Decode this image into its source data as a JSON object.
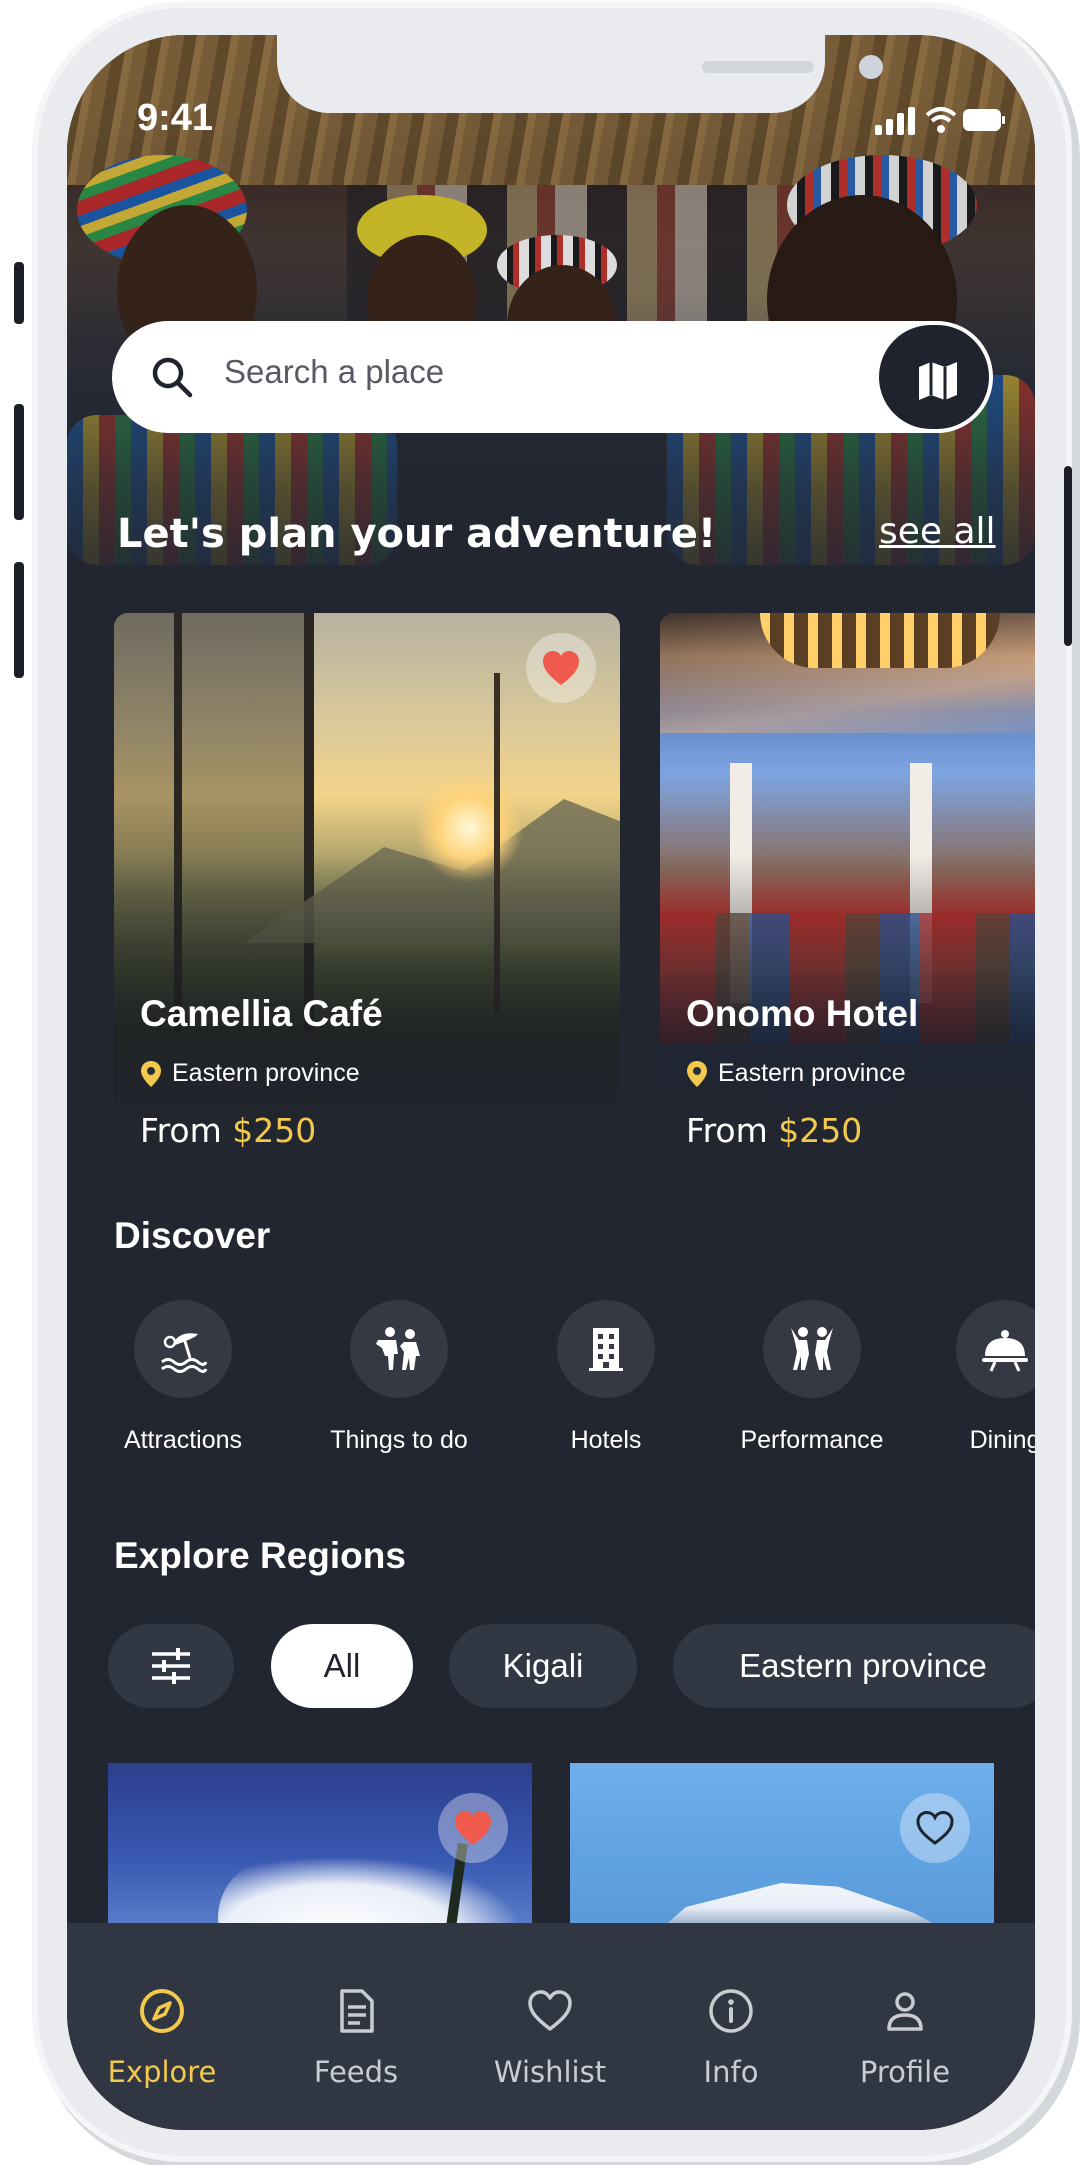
{
  "status_bar": {
    "time": "9:41"
  },
  "search": {
    "placeholder": "Search a place",
    "icon": "search-icon",
    "map_button_icon": "map-icon"
  },
  "plan": {
    "title": "Let's plan your adventure!",
    "see_all": "see all",
    "cards": [
      {
        "name": "Camellia Café",
        "location": "Eastern province",
        "price_prefix": "From",
        "price": "$250",
        "favorited": true
      },
      {
        "name": "Onomo Hotel",
        "location": "Eastern province",
        "price_prefix": "From",
        "price": "$250",
        "favorited": false
      }
    ]
  },
  "discover": {
    "title": "Discover",
    "items": [
      {
        "label": "Attractions",
        "icon": "beach-umbrella-icon"
      },
      {
        "label": "Things to do",
        "icon": "people-activity-icon"
      },
      {
        "label": "Hotels",
        "icon": "building-icon"
      },
      {
        "label": "Performance",
        "icon": "dancers-icon"
      },
      {
        "label": "Dining",
        "icon": "cloche-icon"
      }
    ]
  },
  "regions": {
    "title": "Explore Regions",
    "filter_icon": "sliders-icon",
    "chips": [
      "All",
      "Kigali",
      "Eastern province"
    ],
    "active_chip": "All",
    "cards": [
      {
        "favorited": true
      },
      {
        "favorited": false
      }
    ]
  },
  "nav": {
    "items": [
      {
        "label": "Explore",
        "icon": "compass-icon",
        "active": true
      },
      {
        "label": "Feeds",
        "icon": "document-icon",
        "active": false
      },
      {
        "label": "Wishlist",
        "icon": "heart-outline-icon",
        "active": false
      },
      {
        "label": "Info",
        "icon": "info-icon",
        "active": false
      },
      {
        "label": "Profile",
        "icon": "person-icon",
        "active": false
      }
    ]
  },
  "colors": {
    "background": "#222630",
    "accent": "#f2c94c",
    "favorite": "#ef5a4c",
    "nav_background": "#303642",
    "chip_background": "#313743"
  }
}
